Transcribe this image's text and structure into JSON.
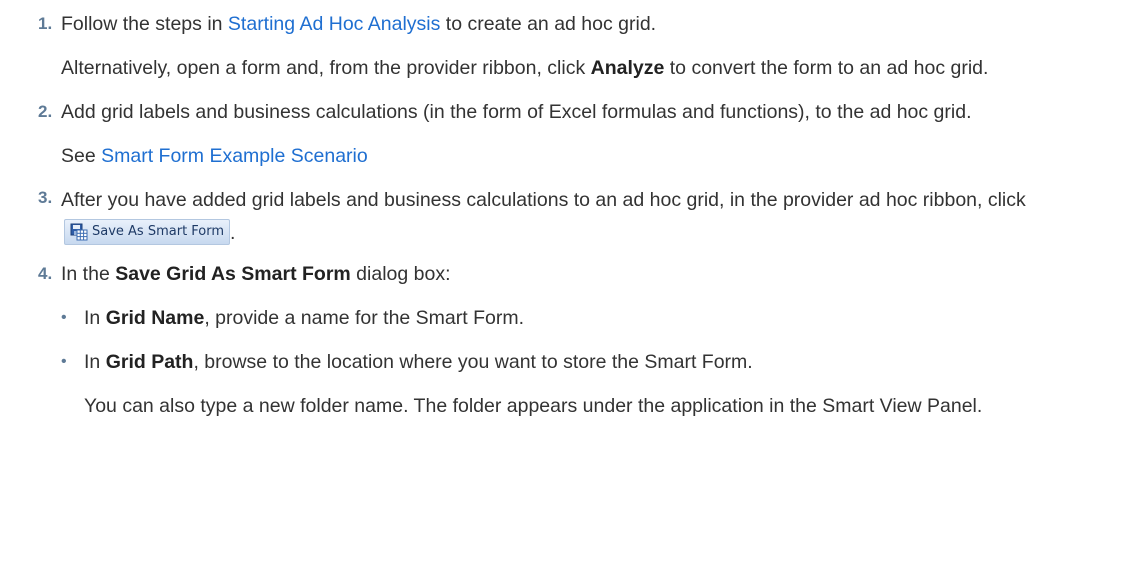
{
  "steps": [
    {
      "number": "1.",
      "line_pre": "Follow the steps in ",
      "link": "Starting Ad Hoc Analysis",
      "line_post": " to create an ad hoc grid.",
      "alt_pre": "Alternatively, open a form and, from the provider ribbon, click ",
      "alt_bold": "Analyze",
      "alt_post": " to convert the form to an ad hoc grid."
    },
    {
      "number": "2.",
      "text": "Add grid labels and business calculations (in the form of Excel formulas and functions), to the ad hoc grid.",
      "see_pre": "See ",
      "see_link": "Smart Form Example Scenario"
    },
    {
      "number": "3.",
      "text_pre": "After you have added grid labels and business calculations to an ad hoc grid, in the provider ad hoc ribbon, click ",
      "button_label": "Save As Smart Form",
      "button_icon": "save-as-smart-form-icon",
      "text_post": "."
    },
    {
      "number": "4.",
      "pre": "In the ",
      "bold": "Save Grid As Smart Form",
      "post": " dialog box:",
      "bullets": [
        {
          "symbol": "•",
          "pre": "In ",
          "bold": "Grid Name",
          "post": ", provide a name for the Smart Form."
        },
        {
          "symbol": "•",
          "pre": "In ",
          "bold": "Grid Path",
          "post": ", browse to the location where you want to store the Smart Form."
        }
      ],
      "note": "You can also type a new folder name. The folder appears under the application in the Smart View Panel."
    }
  ]
}
